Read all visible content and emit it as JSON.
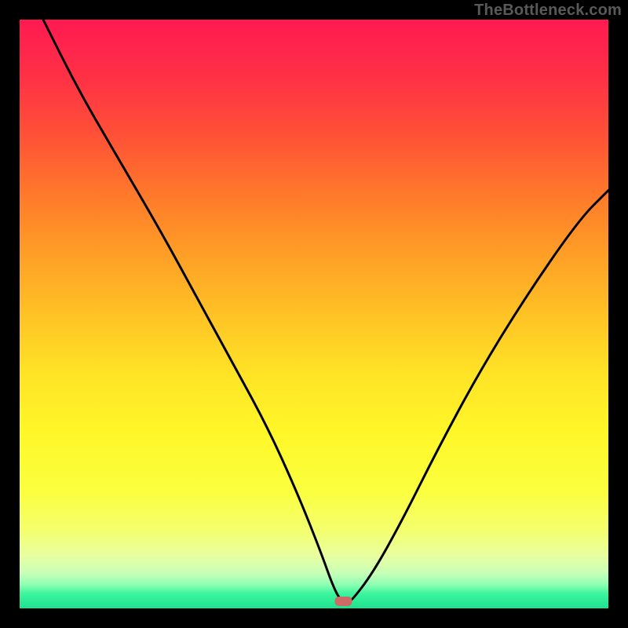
{
  "watermark": "TheBottleneck.com",
  "chart_data": {
    "type": "line",
    "title": "",
    "xlabel": "",
    "ylabel": "",
    "xlim": [
      0,
      100
    ],
    "ylim": [
      0,
      100
    ],
    "background_bands": [
      {
        "stop": 0.0,
        "color": "#ff1a52"
      },
      {
        "stop": 0.1,
        "color": "#ff3145"
      },
      {
        "stop": 0.2,
        "color": "#ff5236"
      },
      {
        "stop": 0.3,
        "color": "#ff7a2a"
      },
      {
        "stop": 0.4,
        "color": "#ff9f26"
      },
      {
        "stop": 0.5,
        "color": "#ffc225"
      },
      {
        "stop": 0.6,
        "color": "#ffe326"
      },
      {
        "stop": 0.7,
        "color": "#fff728"
      },
      {
        "stop": 0.8,
        "color": "#fbff3e"
      },
      {
        "stop": 0.87,
        "color": "#f3ff70"
      },
      {
        "stop": 0.91,
        "color": "#e9ffa0"
      },
      {
        "stop": 0.94,
        "color": "#c8ffb8"
      },
      {
        "stop": 0.96,
        "color": "#8dffb2"
      },
      {
        "stop": 0.975,
        "color": "#3cf59e"
      },
      {
        "stop": 1.0,
        "color": "#1ee28e"
      }
    ],
    "series": [
      {
        "name": "bottleneck-curve",
        "x": [
          4,
          10,
          17,
          24,
          30,
          36,
          42,
          47,
          51,
          53.5,
          55,
          56,
          60,
          65,
          71,
          78,
          86,
          95,
          100
        ],
        "y": [
          100,
          88,
          76,
          64,
          53,
          42,
          31,
          20,
          10,
          3,
          0.8,
          0.8,
          6,
          15,
          27,
          40,
          53,
          66,
          71
        ]
      }
    ],
    "marker": {
      "x": 55,
      "y": 1.2,
      "color": "#cc6a66"
    }
  }
}
